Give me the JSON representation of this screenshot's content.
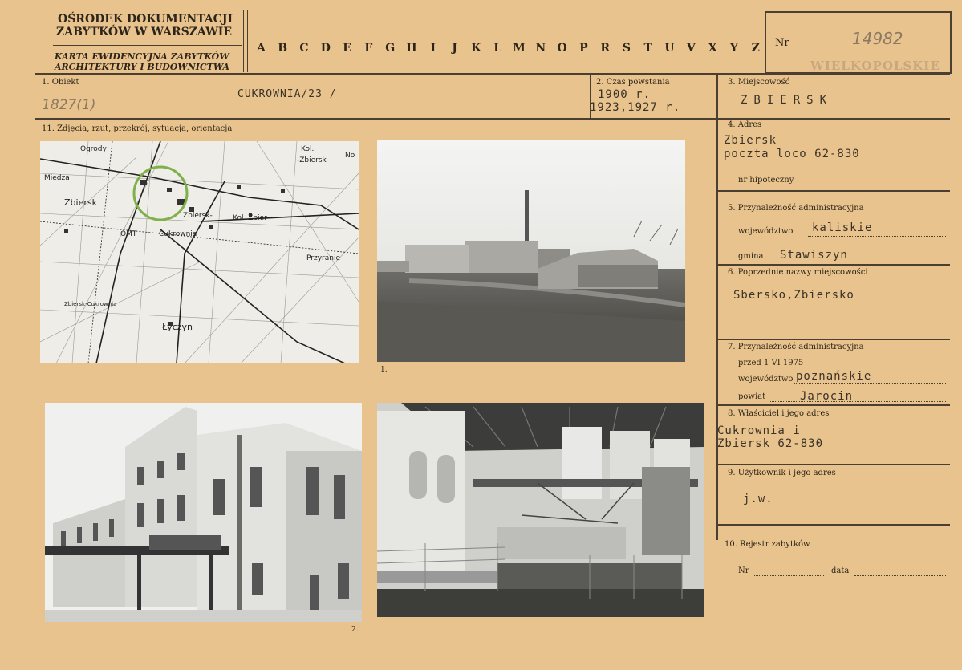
{
  "header": {
    "org_line1": "OŚRODEK DOKUMENTACJI",
    "org_line2": "ZABYTKÓW W WARSZAWIE",
    "card_line1": "KARTA EWIDENCYJNA ZABYTKÓW",
    "card_line2": "ARCHITEKTURY I BUDOWNICTWA",
    "letters": [
      "A",
      "B",
      "C",
      "D",
      "E",
      "F",
      "G",
      "H",
      "I",
      "J",
      "K",
      "L",
      "M",
      "N",
      "O",
      "P",
      "R",
      "S",
      "T",
      "U",
      "V",
      "X",
      "Y",
      "Z"
    ],
    "nr_label": "Nr",
    "nr_value": "14982",
    "stamp_text": "WIELKOPOLSKIE"
  },
  "fields": {
    "obiekt_label": "1. Obiekt",
    "obiekt_value": "CUKROWNIA/23 /",
    "obiekt_handnote": "1827(1)",
    "czas_label": "2. Czas powstania",
    "czas_value1": "1900 r.",
    "czas_value2": "1923,1927 r.",
    "miejscowosc_label": "3. Miejscowość",
    "miejscowosc_value": "ZBIERSK",
    "adres_label": "4. Adres",
    "adres_line1": "Zbiersk",
    "adres_line2": "poczta loco 62-830",
    "hipoteczny_label": "nr hipoteczny",
    "przyn_label": "5. Przynależność administracyjna",
    "woj_label": "województwo",
    "woj_value": "kaliskie",
    "gmina_label": "gmina",
    "gmina_value": "Stawiszyn",
    "poprz_label": "6. Poprzednie nazwy miejscowości",
    "poprz_value": "Sbersko,Zbiersko",
    "przyn2_label": "7. Przynależność administracyjna",
    "przed_label": "przed 1 VI 1975",
    "woj2_label": "województwo",
    "woj2_value": "poznańskie",
    "powiat_label": "powiat",
    "powiat_value": "Jarocin",
    "wlasciciel_label": "8. Właściciel i jego adres",
    "wlasciciel_line1": "Cukrownia i",
    "wlasciciel_line2": "Zbiersk 62-830",
    "uzytkownik_label": "9. Użytkownik i jego adres",
    "uzytkownik_value": "j.w.",
    "rejestr_label": "10. Rejestr zabytków",
    "rejestr_nr_label": "Nr",
    "rejestr_data_label": "data",
    "zdjecia_label": "11. Zdjęcia, rzut, przekrój, sytuacja, orientacja",
    "photo1_caption": "1.",
    "photo2_caption": "2."
  },
  "map": {
    "labels": [
      "Ogrody",
      "Kol.",
      "-Zbiersk",
      "Miedza",
      "Zbiersk",
      "Zbiersk-",
      "Kol. Zbier",
      "OMT",
      "Cukrownia",
      "Przyranie",
      "Łyczyn",
      "Zbiersk-Cukrownia",
      "No"
    ]
  },
  "colors": {
    "card_bg": "#e9c38d",
    "ink": "#2b2418",
    "circle": "#7fb04a"
  }
}
